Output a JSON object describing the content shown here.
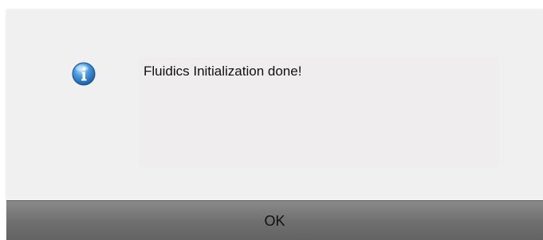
{
  "dialog": {
    "icon": "info-icon",
    "message": "Fluidics Initialization done!",
    "ok_label": "OK"
  },
  "colors": {
    "dialog_bg": "#f0f0f0",
    "button_bg": "#6f6f6f",
    "icon_blue": "#2f7fc8"
  }
}
